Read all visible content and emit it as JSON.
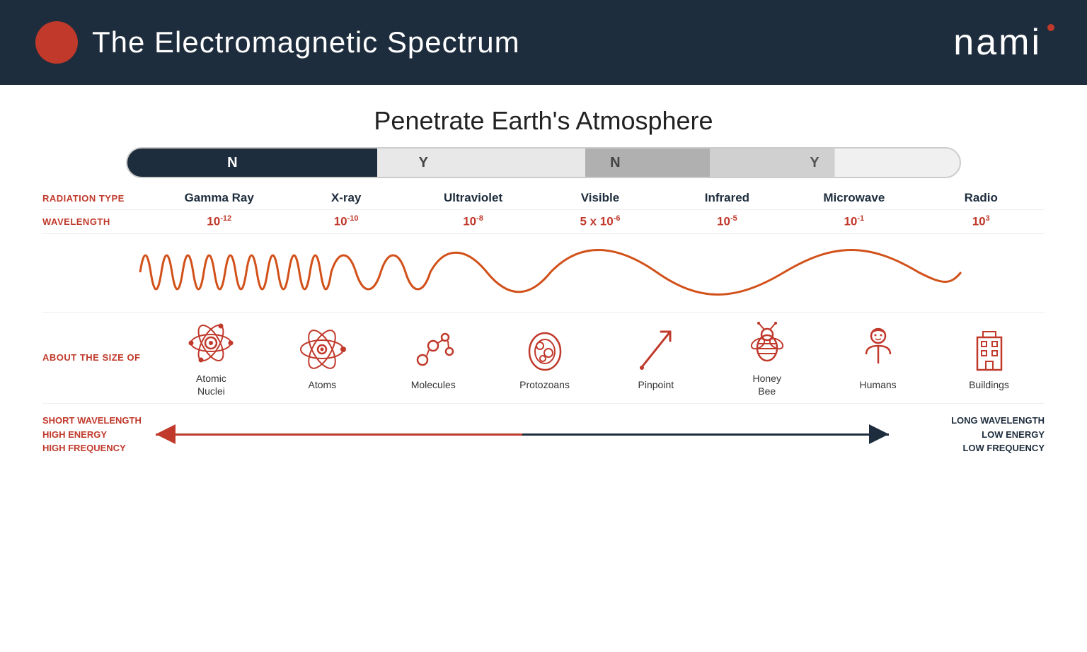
{
  "header": {
    "title": "The Electromagnetic Spectrum",
    "logo": "nami"
  },
  "penetrate": {
    "title": "Penetrate Earth's Atmosphere",
    "bar_labels": [
      "N",
      "Y",
      "N",
      "Y"
    ]
  },
  "radiation": {
    "row_label": "RADIATION TYPE",
    "types": [
      "Gamma Ray",
      "X-ray",
      "Ultraviolet",
      "Visible",
      "Infrared",
      "Microwave",
      "Radio"
    ]
  },
  "wavelength": {
    "row_label": "WAVELENGTH",
    "values": [
      {
        "base": "10",
        "exp": "-12"
      },
      {
        "base": "10",
        "exp": "-10"
      },
      {
        "base": "10",
        "exp": "-8"
      },
      {
        "base": "5 x 10",
        "exp": "-6"
      },
      {
        "base": "10",
        "exp": "-5"
      },
      {
        "base": "10",
        "exp": "-1"
      },
      {
        "base": "10",
        "exp": "3"
      }
    ]
  },
  "size": {
    "row_label": "ABOUT THE SIZE OF",
    "items": [
      {
        "label": "Atomic\nNuclei"
      },
      {
        "label": "Atoms"
      },
      {
        "label": "Molecules"
      },
      {
        "label": "Protozoans"
      },
      {
        "label": "Pinpoint"
      },
      {
        "label": "Honey\nBee"
      },
      {
        "label": "Humans"
      },
      {
        "label": "Buildings"
      }
    ]
  },
  "bottom": {
    "left_lines": [
      "SHORT WAVELENGTH",
      "HIGH ENERGY",
      "HIGH FREQUENCY"
    ],
    "right_lines": [
      "LONG WAVELENGTH",
      "LOW ENERGY",
      "LOW FREQUENCY"
    ]
  }
}
